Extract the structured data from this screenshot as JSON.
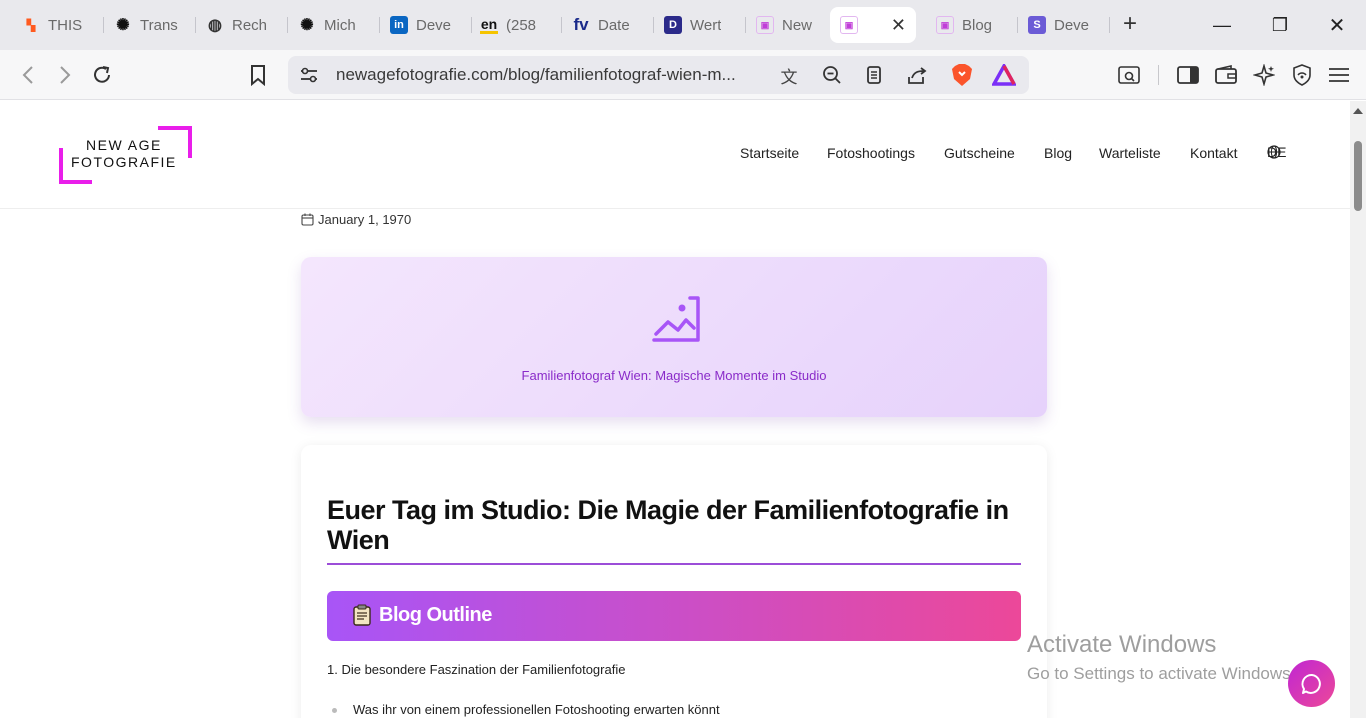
{
  "browser": {
    "tabs": [
      {
        "title": "THIS",
        "icon": "orange-grid-icon"
      },
      {
        "title": "Trans",
        "icon": "openai-icon"
      },
      {
        "title": "Rech",
        "icon": "globe-icon"
      },
      {
        "title": "Mich",
        "icon": "openai-icon"
      },
      {
        "title": "Deve",
        "icon": "linkedin-icon"
      },
      {
        "title": "(258",
        "icon": "en-icon"
      },
      {
        "title": "Date",
        "icon": "fv-icon"
      },
      {
        "title": "Wert",
        "icon": "d-icon"
      },
      {
        "title": "New",
        "icon": "newage-icon"
      },
      {
        "title": "",
        "icon": "newage-icon",
        "active": true
      },
      {
        "title": "Blog",
        "icon": "newage-icon"
      },
      {
        "title": "Deve",
        "icon": "s-icon"
      }
    ],
    "url": "newagefotografie.com/blog/familienfotograf-wien-m..."
  },
  "site": {
    "logo_line1": "NEW AGE",
    "logo_line2": "FOTOGRAFIE",
    "nav": [
      "Startseite",
      "Fotoshootings",
      "Gutscheine",
      "Blog",
      "Warteliste",
      "Kontakt"
    ],
    "language": "DE",
    "accent": "#e91eea"
  },
  "post": {
    "date": "January 1, 1970",
    "hero_caption": "Familienfotograf Wien: Magische Momente im Studio",
    "title": "Euer Tag im Studio: Die Magie der Familienfotografie in Wien",
    "outline_title": "Blog Outline",
    "outline_item_1": "1. Die besondere Faszination der Familienfotografie",
    "outline_bullet_1": "Was ihr von einem professionellen Fotoshooting erwarten könnt"
  },
  "os": {
    "activate_title": "Activate Windows",
    "activate_sub": "Go to Settings to activate Windows."
  }
}
